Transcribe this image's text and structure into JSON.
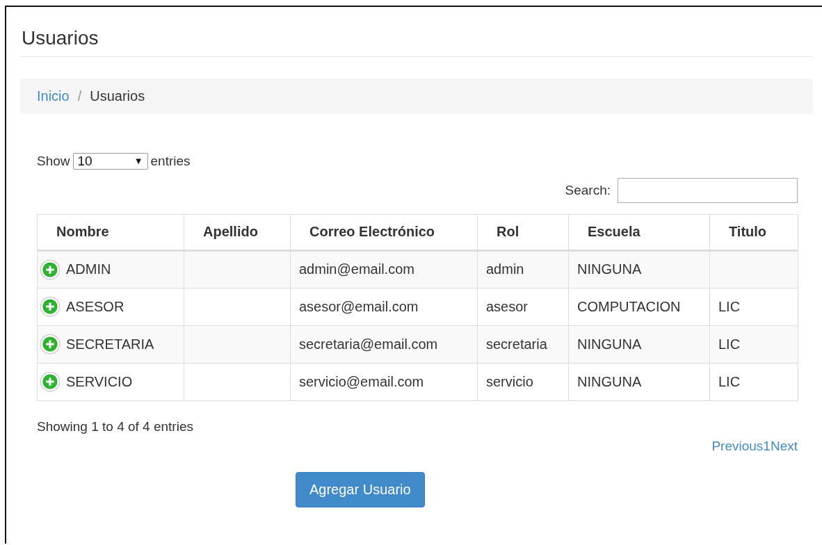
{
  "title": "Usuarios",
  "breadcrumb": [
    {
      "label": "Inicio",
      "kind": "link"
    },
    {
      "label": "Usuarios",
      "kind": "current"
    }
  ],
  "breadcrumb_separator": "/",
  "length": {
    "label_before": "Show",
    "value": "10",
    "caret": "▼",
    "label_after": "entries"
  },
  "search": {
    "label": "Search:"
  },
  "table": {
    "columns": [
      "Nombre",
      "Apellido",
      "Correo Electrónico",
      "Rol",
      "Escuela",
      "Titulo"
    ],
    "rows": [
      {
        "cells": [
          "ADMIN",
          "",
          "admin@email.com",
          "admin",
          "NINGUNA",
          ""
        ]
      },
      {
        "cells": [
          "ASESOR",
          "",
          "asesor@email.com",
          "asesor",
          "COMPUTACION",
          "LIC"
        ]
      },
      {
        "cells": [
          "SECRETARIA",
          "",
          "secretaria@email.com",
          "secretaria",
          "NINGUNA",
          "LIC"
        ]
      },
      {
        "cells": [
          "SERVICIO",
          "",
          "servicio@email.com",
          "servicio",
          "NINGUNA",
          "LIC"
        ]
      }
    ]
  },
  "info": "Showing 1 to 4 of 4 entries",
  "pagination": [
    "Previous",
    "1",
    "Next"
  ],
  "add_button": "Agregar Usuario"
}
